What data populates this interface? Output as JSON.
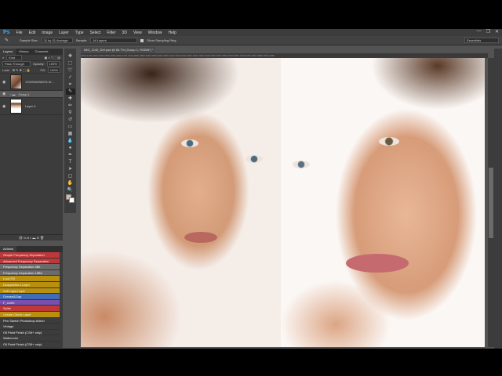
{
  "app": {
    "logo": "Ps"
  },
  "menu": [
    "File",
    "Edit",
    "Image",
    "Layer",
    "Type",
    "Select",
    "Filter",
    "3D",
    "View",
    "Window",
    "Help"
  ],
  "window_buttons": [
    "—",
    "❐",
    "✕"
  ],
  "options": {
    "sample_size_label": "Sample Size:",
    "sample_size": "31 by 31 Average",
    "sample_label": "Sample:",
    "sample": "All Layers",
    "show_ring": "Show Sampling Ring",
    "workspace": "Essentials"
  },
  "layers_panel": {
    "tabs": [
      "Layers",
      "History",
      "Channels"
    ],
    "filter": "Kind",
    "blend_mode": "Pass Through",
    "opacity_label": "Opacity:",
    "opacity": "100%",
    "lock_label": "Lock:",
    "fill_label": "Fill:",
    "fill": "100%",
    "layers": [
      {
        "name": "1292948298291.0t..."
      },
      {
        "name": "Group 1"
      },
      {
        "name": "Layer 0"
      }
    ]
  },
  "actions_panel": {
    "title": "Actions",
    "items": [
      {
        "label": "Simple Frequency Separation",
        "color": "#c0373a"
      },
      {
        "label": "Advanced Frequency Separation",
        "color": "#c0373a"
      },
      {
        "label": "Frequency Separation 8Bit",
        "color": "#6b6b6b"
      },
      {
        "label": "Frequency Separation 16Bit",
        "color": "#6b6b6b"
      },
      {
        "label": "Luck Fill",
        "color": "#b8900e"
      },
      {
        "label": "Dodge&Burn Layer",
        "color": "#b8900e"
      },
      {
        "label": "Soft Light Layer",
        "color": "#b8900e"
      },
      {
        "label": "Grease&Gap",
        "color": "#3f6db5"
      },
      {
        "label": "F_comb",
        "color": "#7a4fae"
      },
      {
        "label": "Spike",
        "color": "#c0373a"
      },
      {
        "label": "Create Check Layer",
        "color": "#b8900e"
      },
      {
        "label": "Pen Sketch Photoshop Action",
        "color": "#3c3c3c"
      },
      {
        "label": "Vintage",
        "color": "#3c3c3c"
      },
      {
        "label": "Oil Paint Finish (CS6+ only)",
        "color": "#3c3c3c"
      },
      {
        "label": "Watercolor",
        "color": "#3c3c3c"
      },
      {
        "label": "Oil Paint Finish (CS6+ only)",
        "color": "#3c3c3c"
      }
    ]
  },
  "document": {
    "tab_title": "IMG_1140_Def.psd @ 66.7% (Group 1, RGB/8*) *  ✕",
    "ruler": "2350  2400  2450  2500  2550  2600  2650  2700  2750  2800  2850  2900  2950  3000  3050  3100  3150  3200  3250  3300  3350  3400  3450  3500  3550  3600  3650  3700  3750  3800  3850  3900  3950"
  }
}
